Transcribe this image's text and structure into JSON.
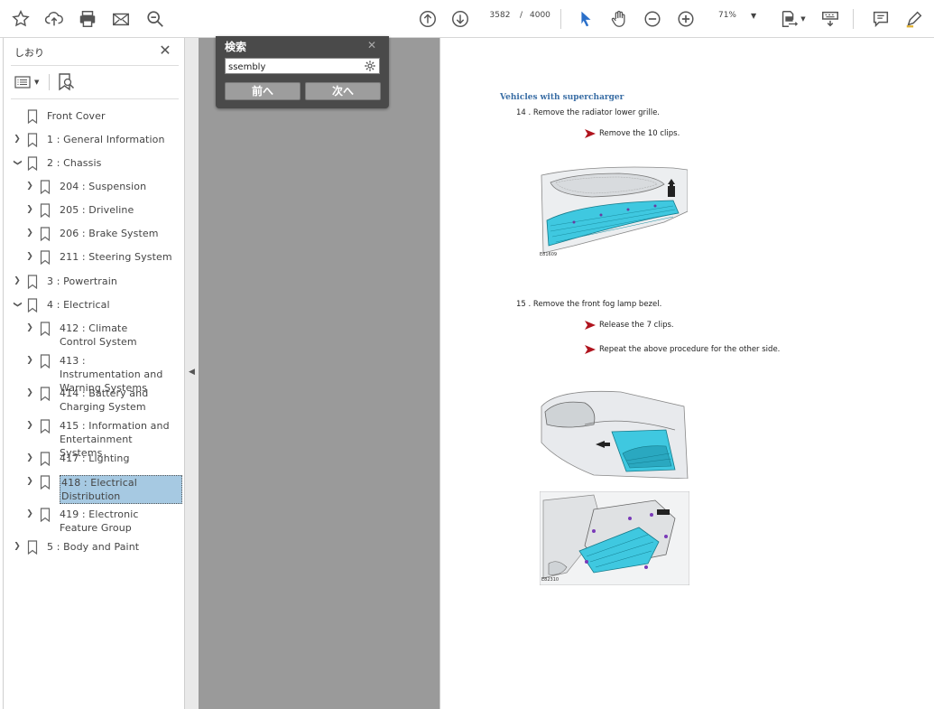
{
  "toolbar": {
    "page_current": "3582",
    "page_separator": "/",
    "page_total": "4000",
    "zoom": "71%",
    "icons": [
      "star-icon",
      "cloud-upload-icon",
      "print-icon",
      "mail-icon",
      "zoom-search-icon",
      "page-up-icon",
      "page-down-icon",
      "select-cursor-icon",
      "hand-icon",
      "zoom-out-icon",
      "zoom-in-icon",
      "fit-page-icon",
      "keyboard-read-icon",
      "comment-icon",
      "pen-icon"
    ]
  },
  "sidebar": {
    "title": "しおり",
    "bookmarks": [
      {
        "label": "Front Cover"
      },
      {
        "label": "1 : General Information"
      },
      {
        "label": "2 : Chassis"
      },
      {
        "label": "204 : Suspension"
      },
      {
        "label": "205 : Driveline"
      },
      {
        "label": "206 : Brake System"
      },
      {
        "label": "211 : Steering System"
      },
      {
        "label": "3 : Powertrain"
      },
      {
        "label": "4 : Electrical"
      },
      {
        "label": "412 : Climate Control System"
      },
      {
        "label": "413 : Instrumentation and Warning Systems"
      },
      {
        "label": "414 : Battery and Charging System"
      },
      {
        "label": "415 : Information and Entertainment Systems"
      },
      {
        "label": "417 : Lighting"
      },
      {
        "label": "418 : Electrical Distribution"
      },
      {
        "label": "419 : Electronic Feature Group"
      },
      {
        "label": "5 : Body and Paint"
      }
    ]
  },
  "search": {
    "title": "検索",
    "query": "ssembly",
    "prev_label": "前へ",
    "next_label": "次へ"
  },
  "document": {
    "heading": "Vehicles with supercharger",
    "step14": "14 . Remove the radiator lower grille.",
    "step14_sub": "Remove the 10 clips.",
    "fig1_code": "E81609",
    "step15": "15 . Remove the front fog lamp bezel.",
    "step15_sub1": "Release the 7 clips.",
    "step15_sub2": "Repeat the above procedure for the other side.",
    "fig3_code": "E82310"
  },
  "colors": {
    "accent_blue": "#3a6ea5",
    "selection": "#a6c9e2",
    "workspace_gray": "#9a9a9a",
    "search_panel": "#4a4a4a",
    "bullet_red": "#b0141e",
    "grille_cyan": "#3fc8e0"
  }
}
